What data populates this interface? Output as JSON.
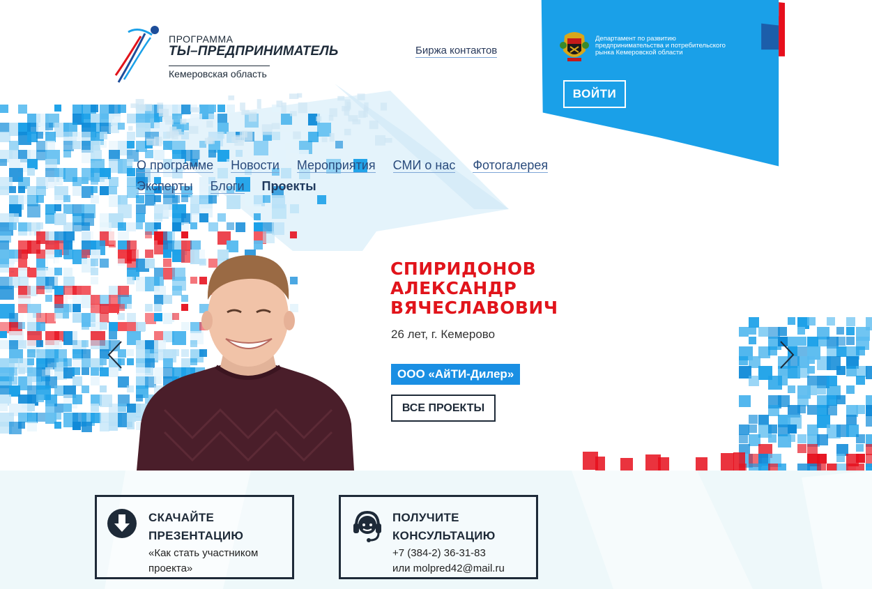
{
  "header": {
    "logo": {
      "line1": "ПРОГРАММА",
      "line2": "ТЫ–ПРЕДПРИНИМАТЕЛЬ",
      "region": "Кемеровская область"
    },
    "contacts_link": "Биржа контактов",
    "department": {
      "line1": "Департамент по развитию",
      "line2": "предпринимательства и потребительского",
      "line3": "рынка Кемеровской области"
    },
    "login_label": "ВОЙТИ"
  },
  "nav": {
    "row1": [
      "О программе",
      "Новости",
      "Мероприятия",
      "СМИ о нас",
      "Фотогалерея"
    ],
    "row2": [
      "Эксперты",
      "Блоги",
      "Проекты"
    ],
    "active": "Проекты"
  },
  "slide": {
    "name_lines": [
      "СПИРИДОНОВ",
      "АЛЕКСАНДР",
      "ВЯЧЕСЛАВОВИЧ"
    ],
    "meta": "26 лет, г. Кемерово",
    "company": "ООО «АйТИ-Дилер»",
    "all_projects_label": "ВСЕ ПРОЕКТЫ"
  },
  "cards": {
    "presentation": {
      "icon": "download-circle-icon",
      "title_lines": [
        "СКАЧАЙТЕ",
        "ПРЕЗЕНТАЦИЮ"
      ],
      "text_lines": [
        "«Как стать участником",
        "проекта»"
      ]
    },
    "consultation": {
      "icon": "headset-operator-icon",
      "title_lines": [
        "ПОЛУЧИТЕ",
        "КОНСУЛЬТАЦИЮ"
      ],
      "text_lines": [
        "+7 (384-2) 36-31-83",
        "или molpred42@mail.ru"
      ]
    }
  },
  "colors": {
    "brand_blue": "#1a8fe3",
    "brand_red": "#e1141b",
    "navy": "#1e2a38",
    "link_blue": "#2a4b7c"
  }
}
